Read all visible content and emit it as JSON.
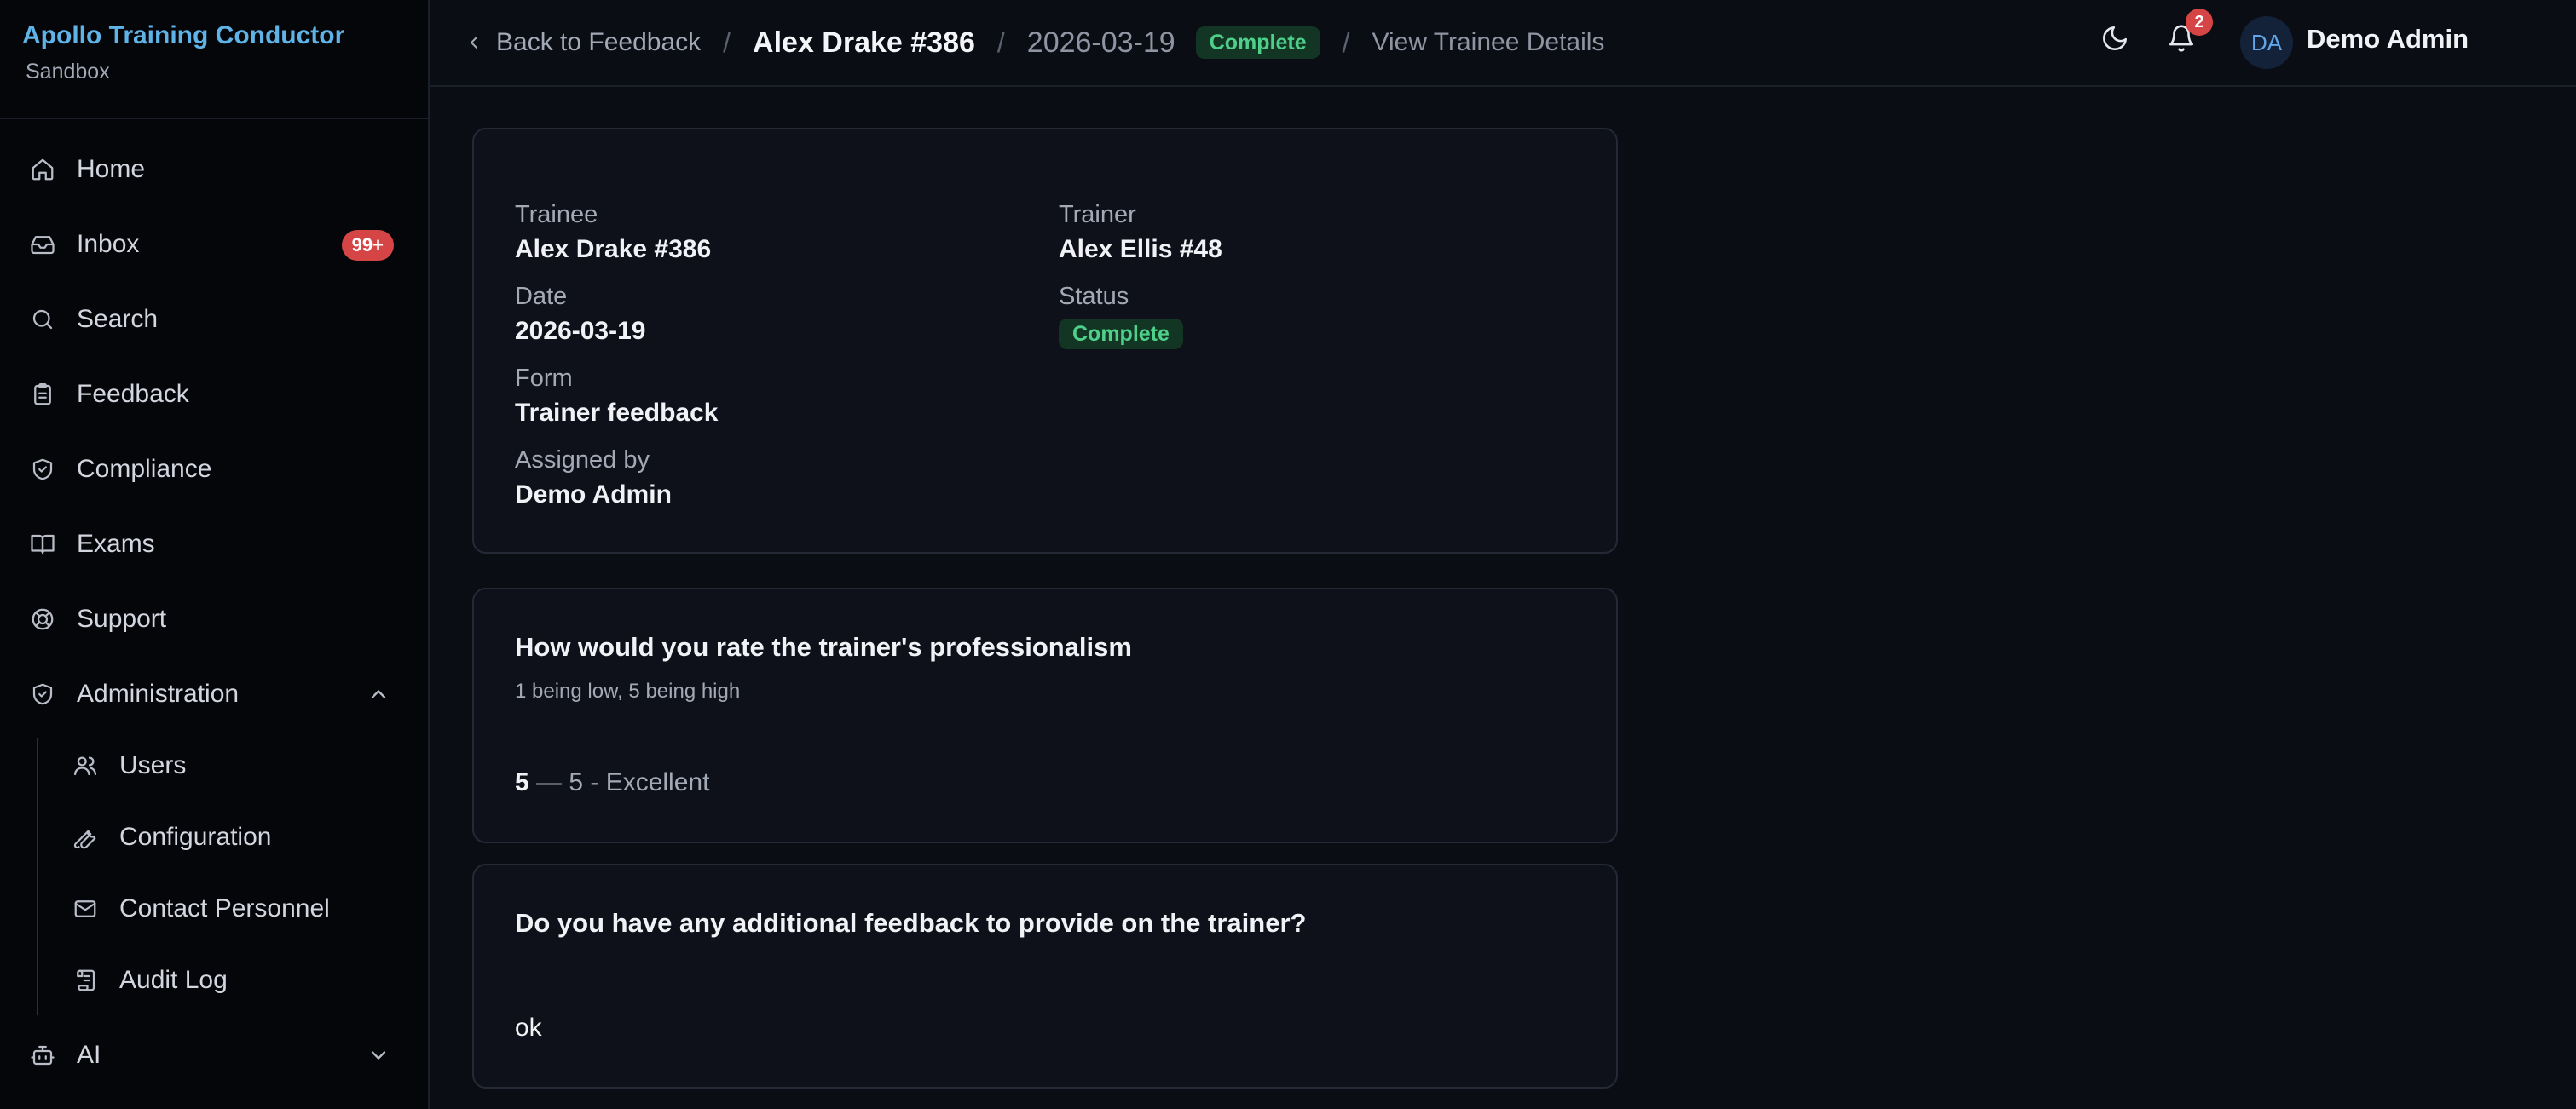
{
  "brand": {
    "title": "Apollo Training Conductor",
    "subtitle": "Sandbox"
  },
  "sidebar": {
    "items": [
      {
        "label": "Home"
      },
      {
        "label": "Inbox",
        "badge": "99+"
      },
      {
        "label": "Search"
      },
      {
        "label": "Feedback"
      },
      {
        "label": "Compliance"
      },
      {
        "label": "Exams"
      },
      {
        "label": "Support"
      },
      {
        "label": "Administration"
      }
    ],
    "admin_items": [
      {
        "label": "Users"
      },
      {
        "label": "Configuration"
      },
      {
        "label": "Contact Personnel"
      },
      {
        "label": "Audit Log"
      }
    ],
    "ai": {
      "label": "AI"
    }
  },
  "breadcrumb": {
    "back": "Back to Feedback",
    "sep": "/",
    "title": "Alex Drake #386",
    "date": "2026-03-19",
    "status": "Complete",
    "view": "View Trainee Details"
  },
  "header": {
    "notifications": "2",
    "avatar_initials": "DA",
    "user_name": "Demo Admin"
  },
  "summary": {
    "trainee_label": "Trainee",
    "trainee": "Alex Drake #386",
    "trainer_label": "Trainer",
    "trainer": "Alex Ellis #48",
    "date_label": "Date",
    "date": "2026-03-19",
    "status_label": "Status",
    "status": "Complete",
    "form_label": "Form",
    "form": "Trainer feedback",
    "assigned_label": "Assigned by",
    "assigned": "Demo Admin"
  },
  "questions": [
    {
      "title": "How would you rate the trainer's professionalism",
      "hint": "1 being low, 5 being high",
      "answer_value": "5",
      "answer_text": " — 5 - Excellent"
    },
    {
      "title": "Do you have any additional feedback to provide on the trainer?",
      "answer": "ok"
    }
  ],
  "colors": {
    "brand": "#5fb3e6",
    "complete_bg": "#123524",
    "complete_text": "#4fd08a",
    "badge": "#d64545"
  }
}
